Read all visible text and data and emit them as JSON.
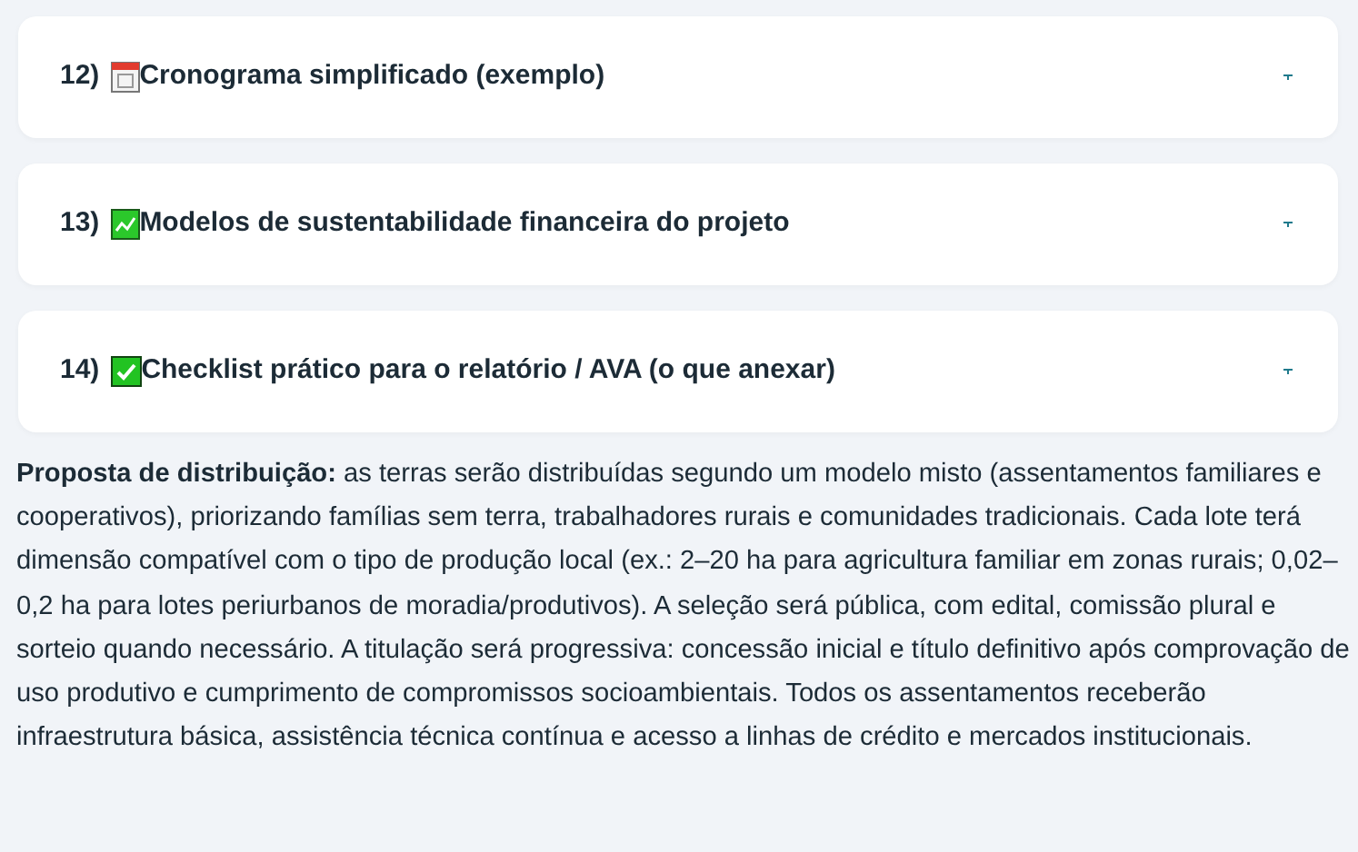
{
  "sections": [
    {
      "number": "12)",
      "kind": "calendar",
      "title": "Cronograma simplificado (exemplo)",
      "expanded": false
    },
    {
      "number": "13)",
      "kind": "chart",
      "title": "Modelos de sustentabilidade financeira do projeto",
      "expanded": false
    },
    {
      "number": "14)",
      "kind": "check",
      "title": "Checklist prático para o relatório / AVA (o que anexar)",
      "expanded": false
    }
  ],
  "paragraph": "**Proposta de distribuição:** as terras serão distribuídas segundo um modelo misto (assentamentos familiares e cooperativos), priorizando famílias sem terra, trabalhadores rurais e comunidades tradicionais. Cada lote terá dimensão compatível com o tipo de produção local (ex.: 2–20 ha para agricultura familiar em zonas rurais; 0,02–0,2 ha para lotes periurbanos de moradia/produtivos). A seleção será pública, com edital, comissão plural e sorteio quando necessário. A titulação será progressiva: concessão inicial e título definitivo após comprovação de uso produtivo e cumprimento de compromissos socioambientais. Todos os assentamentos receberão infraestrutura básica, assistência técnica contínua e acesso a linhas de crédito e mercados institucionais."
}
